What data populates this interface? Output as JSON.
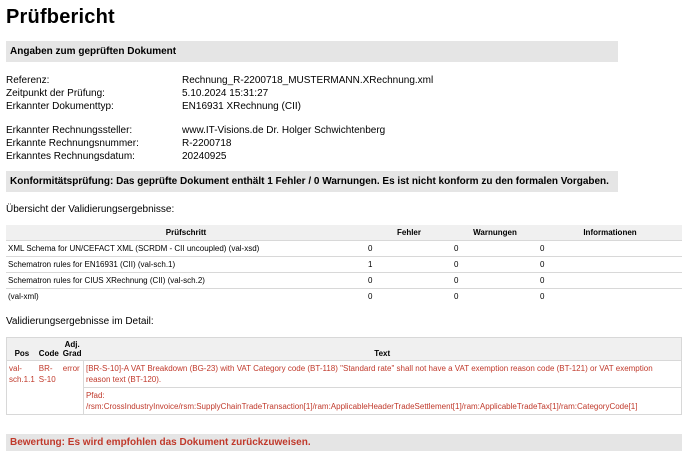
{
  "title": "Prüfbericht",
  "section_document": "Angaben zum geprüften Dokument",
  "document_info": [
    {
      "label": "Referenz:",
      "value": "Rechnung_R-2200718_MUSTERMANN.XRechnung.xml"
    },
    {
      "label": "Zeitpunkt der Prüfung:",
      "value": "5.10.2024 15:31:27"
    },
    {
      "label": "Erkannter Dokumenttyp:",
      "value": "EN16931 XRechnung (CII)"
    }
  ],
  "invoice_info": [
    {
      "label": "Erkannter Rechnungssteller:",
      "value": "www.IT-Visions.de Dr. Holger Schwichtenberg"
    },
    {
      "label": "Erkannte Rechnungsnummer:",
      "value": "R-2200718"
    },
    {
      "label": "Erkanntes Rechnungsdatum:",
      "value": "20240925"
    }
  ],
  "conformity": "Konformitätsprüfung: Das geprüfte Dokument enthält 1 Fehler / 0 Warnungen. Es ist nicht konform zu den formalen Vorgaben.",
  "overview_heading": "Übersicht der Validierungsergebnisse:",
  "overview_table": {
    "headers": {
      "step": "Prüfschritt",
      "errors": "Fehler",
      "warnings": "Warnungen",
      "info": "Informationen"
    },
    "rows": [
      {
        "step": "XML Schema for UN/CEFACT XML (SCRDM - CII uncoupled) (val-xsd)",
        "errors": "0",
        "warnings": "0",
        "info": "0"
      },
      {
        "step": "Schematron rules for EN16931 (CII) (val-sch.1)",
        "errors": "1",
        "warnings": "0",
        "info": "0"
      },
      {
        "step": "Schematron rules for CIUS XRechnung (CII) (val-sch.2)",
        "errors": "0",
        "warnings": "0",
        "info": "0"
      },
      {
        "step": "(val-xml)",
        "errors": "0",
        "warnings": "0",
        "info": "0"
      }
    ]
  },
  "detail_heading": "Validierungsergebnisse im Detail:",
  "detail_table": {
    "headers": {
      "pos": "Pos",
      "code": "Code",
      "grade_line1": "Adj.",
      "grade_line2": "Grad",
      "text": "Text"
    },
    "rows": [
      {
        "pos": "val-sch.1.1",
        "code": "BR-S-10",
        "grade": "error",
        "text": "[BR-S-10]-A VAT Breakdown (BG-23) with VAT Category code (BT-118) \"Standard rate\" shall not have a VAT exemption reason code (BT-121) or VAT exemption reason text (BT-120).",
        "path_label": "Pfad:",
        "path": "/rsm:CrossIndustryInvoice/rsm:SupplyChainTradeTransaction[1]/ram:ApplicableHeaderTradeSettlement[1]/ram:ApplicableTradeTax[1]/ram:CategoryCode[1]"
      }
    ]
  },
  "assessment": "Bewertung: Es wird empfohlen das Dokument zurückzuweisen.",
  "colors": {
    "error_text": "#c0392b",
    "bar_bg": "#e5e5e5",
    "table_header_bg": "#f0f0f0"
  }
}
